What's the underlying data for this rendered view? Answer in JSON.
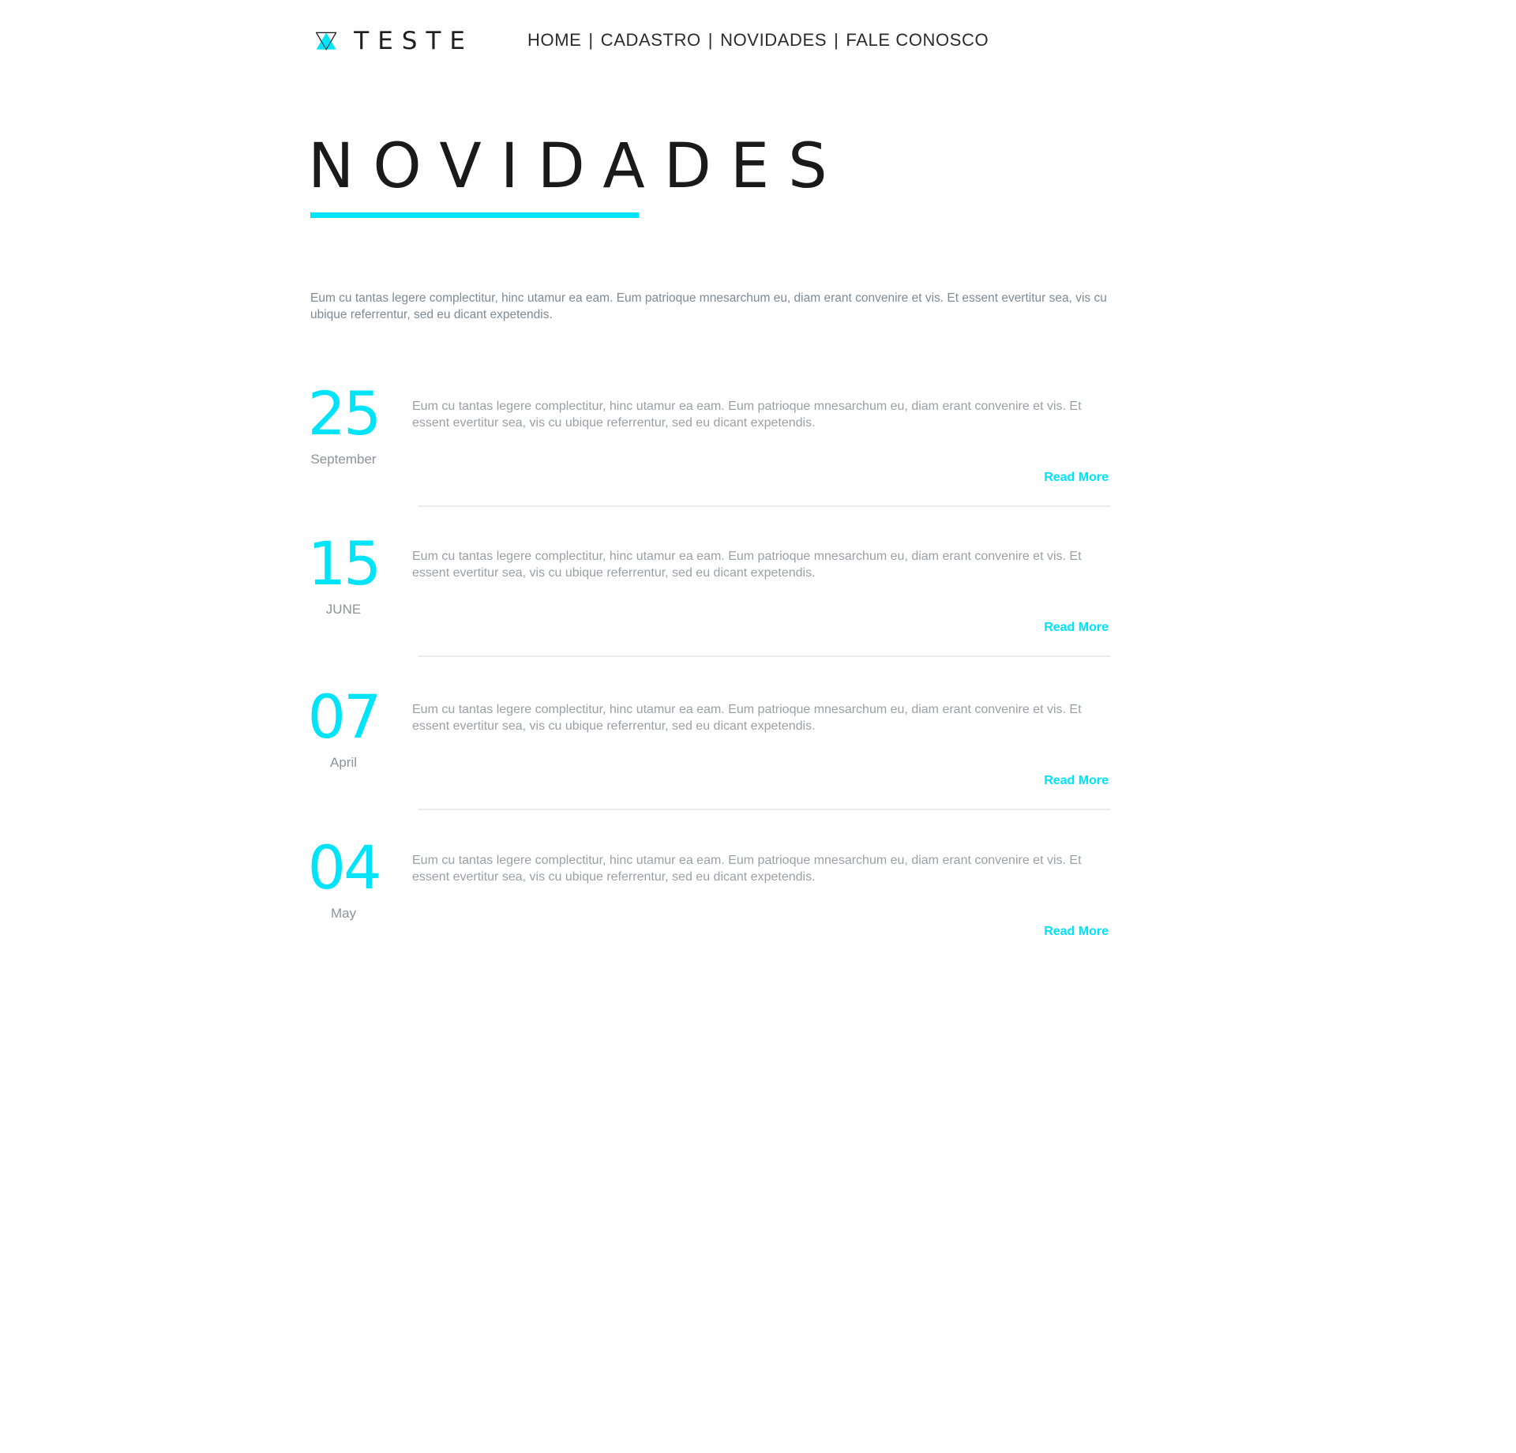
{
  "brand": {
    "name": "TESTE",
    "accent_color": "#00e3f9",
    "logo_icon": "triangle-logo-icon"
  },
  "nav": {
    "items": [
      "HOME",
      "CADASTRO",
      "NOVIDADES",
      "FALE CONOSCO"
    ],
    "separator": "|"
  },
  "page": {
    "title": "NOVIDADES",
    "intro": "Eum cu tantas legere complectitur, hinc utamur ea eam. Eum patrioque mnesarchum eu, diam erant convenire et vis. Et essent evertitur sea, vis cu ubique referrentur, sed eu dicant expetendis."
  },
  "news": [
    {
      "day": "25",
      "month": "September",
      "text": "Eum cu tantas legere complectitur, hinc utamur ea eam. Eum patrioque mnesarchum eu, diam erant convenire et vis. Et essent evertitur sea, vis cu ubique referrentur, sed eu dicant expetendis.",
      "link": "Read More"
    },
    {
      "day": "15",
      "month": "JUNE",
      "text": "Eum cu tantas legere complectitur, hinc utamur ea eam. Eum patrioque mnesarchum eu, diam erant convenire et vis. Et essent evertitur sea, vis cu ubique referrentur, sed eu dicant expetendis.",
      "link": "Read More"
    },
    {
      "day": "07",
      "month": "April",
      "text": "Eum cu tantas legere complectitur, hinc utamur ea eam. Eum patrioque mnesarchum eu, diam erant convenire et vis. Et essent evertitur sea, vis cu ubique referrentur, sed eu dicant expetendis.",
      "link": "Read More"
    },
    {
      "day": "04",
      "month": "May",
      "text": "Eum cu tantas legere complectitur, hinc utamur ea eam. Eum patrioque mnesarchum eu, diam erant convenire et vis. Et essent evertitur sea, vis cu ubique referrentur, sed eu dicant expetendis.",
      "link": "Read More"
    }
  ]
}
